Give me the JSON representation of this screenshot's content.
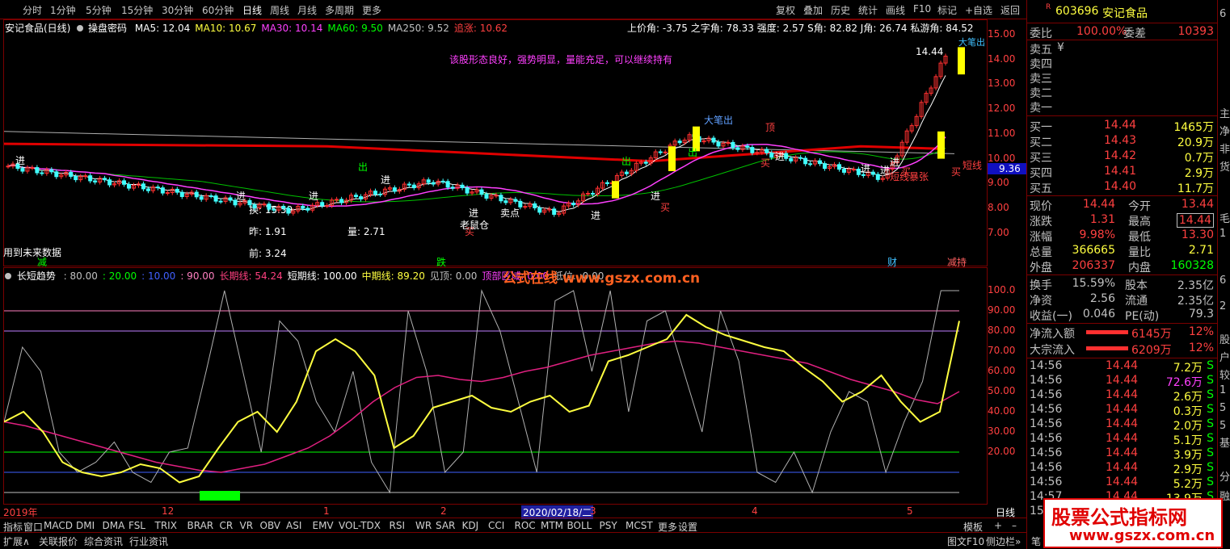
{
  "toolbar": {
    "periods": [
      "分时",
      "1分钟",
      "5分钟",
      "15分钟",
      "30分钟",
      "60分钟",
      "日线",
      "周线",
      "月线",
      "多周期",
      "更多"
    ],
    "active_period": "日线",
    "actions": [
      "复权",
      "叠加",
      "历史",
      "统计",
      "画线",
      "F10",
      "标记",
      "+自选",
      "返回"
    ]
  },
  "main_chart": {
    "stock_title": "安记食品(日线)",
    "indicator_name": "操盘密码",
    "ma_values": [
      {
        "label": "MA5: 12.04",
        "color": "#ffffff"
      },
      {
        "label": "MA10: 10.67",
        "color": "#ffff40"
      },
      {
        "label": "MA30: 10.14",
        "color": "#ff40ff"
      },
      {
        "label": "MA60: 9.50",
        "color": "#00ff00"
      },
      {
        "label": "MA250: 9.52",
        "color": "#c0c0c0"
      },
      {
        "label": "追涨: 10.62",
        "color": "#ff4040"
      }
    ],
    "right_stats": "上价角: -3.75  之字角: 78.33  强度: 2.57  S角: 82.82  J角: 26.74  私游角: 84.52",
    "comment": "该股形态良好，强势明显，量能充足，可以继续持有",
    "annotation_top": "大笔出",
    "price_peak": "14.44",
    "price_current": "9.36",
    "note_future": "用到未来数据",
    "stats_labels": [
      "换: 15.59",
      "昨: 1.91",
      "量: 2.71",
      "前: 3.24"
    ],
    "markers": [
      "进",
      "进",
      "进",
      "进",
      "出",
      "进",
      "出",
      "进",
      "进",
      "买",
      "出",
      "进",
      "买",
      "进",
      "买",
      "顶",
      "进",
      "进",
      "买",
      "大笔出",
      "短线",
      "短线暴张",
      "买",
      "卖点",
      "老鼠仓"
    ],
    "bottom_tags": [
      "减",
      "跌",
      "财",
      "减持"
    ],
    "price_axis": [
      "15.00",
      "14.00",
      "13.00",
      "12.00",
      "11.00",
      "10.00",
      "9.00",
      "8.00",
      "7.00"
    ],
    "colors": {
      "up": "#ff3030",
      "down": "#40ffff",
      "yellow_bar": "#ffff00",
      "ma_red": "#ff0000"
    }
  },
  "sub_chart": {
    "title": "长短趋势",
    "params": [
      {
        "label": ": 80.00",
        "color": "#c0c0c0"
      },
      {
        "label": ": 20.00",
        "color": "#00ff00"
      },
      {
        "label": ": 10.00",
        "color": "#4060ff"
      },
      {
        "label": ": 90.00",
        "color": "#ff80c0"
      },
      {
        "label": "长期线: 54.24",
        "color": "#ff4080"
      },
      {
        "label": "短期线: 100.00",
        "color": "#ffffff"
      },
      {
        "label": "中期线: 89.20",
        "color": "#ffff40"
      },
      {
        "label": "见顶: 0.00",
        "color": "#c0c0c0"
      },
      {
        "label": "顶部区域: 0.00",
        "color": "#ff40ff"
      },
      {
        "label": "低位..:0.00",
        "color": "#c0c0c0"
      }
    ],
    "axis": [
      "100.0",
      "90.00",
      "80.00",
      "70.00",
      "60.00",
      "50.00",
      "40.00",
      "30.00",
      "20.00"
    ]
  },
  "timeline": {
    "labels": [
      "2019年",
      "12",
      "1",
      "2",
      "2020/02/18/二",
      "3",
      "4",
      "5"
    ],
    "period_label": "日线"
  },
  "indicator_tabs": [
    "指标",
    "窗口",
    "MACD",
    "DMI",
    "DMA",
    "FSL",
    "TRIX",
    "BRAR",
    "CR",
    "VR",
    "OBV",
    "ASI",
    "EMV",
    "VOL-TDX",
    "RSI",
    "WR",
    "SAR",
    "KDJ",
    "CCI",
    "ROC",
    "MTM",
    "BOLL",
    "PSY",
    "MCST",
    "更多",
    "设置"
  ],
  "bottom_tabs": [
    "扩展∧",
    "关联报价",
    "综合资讯",
    "行业资讯"
  ],
  "bottom_right": [
    "模板",
    "+",
    "–",
    "图文F10",
    "侧边栏»",
    "笔"
  ],
  "watermark": {
    "top": "公式在线  www.gszx.com.cn",
    "box_line1": "股票公式指标网",
    "box_line2": "www.gszx.com.cn"
  },
  "quote_panel": {
    "code": "603696",
    "name": "安记食品",
    "weibi_label": "委比",
    "weibi": "100.00%",
    "weicha_label": "委差",
    "weicha": "10393",
    "sell": [
      {
        "label": "卖五",
        "price": "¥",
        "vol": ""
      },
      {
        "label": "卖四",
        "price": "",
        "vol": ""
      },
      {
        "label": "卖三",
        "price": "",
        "vol": ""
      },
      {
        "label": "卖二",
        "price": "",
        "vol": ""
      },
      {
        "label": "卖一",
        "price": "",
        "vol": ""
      }
    ],
    "buy": [
      {
        "label": "买一",
        "price": "14.44",
        "vol": "1465万"
      },
      {
        "label": "买二",
        "price": "14.43",
        "vol": "20.9万"
      },
      {
        "label": "买三",
        "price": "14.42",
        "vol": "0.7万"
      },
      {
        "label": "买四",
        "price": "14.41",
        "vol": "2.9万"
      },
      {
        "label": "买五",
        "price": "14.40",
        "vol": "11.7万"
      }
    ],
    "stats": [
      {
        "l1": "现价",
        "v1": "14.44",
        "l2": "今开",
        "v2": "13.44"
      },
      {
        "l1": "涨跌",
        "v1": "1.31",
        "l2": "最高",
        "v2": "14.44"
      },
      {
        "l1": "涨幅",
        "v1": "9.98%",
        "l2": "最低",
        "v2": "13.30"
      },
      {
        "l1": "总量",
        "v1": "366665",
        "l2": "量比",
        "v2": "2.71"
      },
      {
        "l1": "外盘",
        "v1": "206337",
        "l2": "内盘",
        "v2": "160328"
      }
    ],
    "stats2": [
      {
        "l1": "换手",
        "v1": "15.59%",
        "l2": "股本",
        "v2": "2.35亿"
      },
      {
        "l1": "净资",
        "v1": "2.56",
        "l2": "流通",
        "v2": "2.35亿"
      },
      {
        "l1": "收益(一)",
        "v1": "0.046",
        "l2": "PE(动)",
        "v2": "79.3"
      }
    ],
    "flows": [
      {
        "label": "净流入额",
        "value": "6145万",
        "pct": "12%"
      },
      {
        "label": "大宗流入",
        "value": "6209万",
        "pct": "12%"
      }
    ],
    "ticks": [
      {
        "t": "14:56",
        "p": "14.44",
        "v": "7.2万",
        "s": "S"
      },
      {
        "t": "14:56",
        "p": "14.44",
        "v": "72.6万",
        "s": "S"
      },
      {
        "t": "14:56",
        "p": "14.44",
        "v": "2.6万",
        "s": "S"
      },
      {
        "t": "14:56",
        "p": "14.44",
        "v": "0.3万",
        "s": "S"
      },
      {
        "t": "14:56",
        "p": "14.44",
        "v": "2.0万",
        "s": "S"
      },
      {
        "t": "14:56",
        "p": "14.44",
        "v": "5.1万",
        "s": "S"
      },
      {
        "t": "14:56",
        "p": "14.44",
        "v": "3.9万",
        "s": "S"
      },
      {
        "t": "14:56",
        "p": "14.44",
        "v": "2.9万",
        "s": "S"
      },
      {
        "t": "14:56",
        "p": "14.44",
        "v": "5.2万",
        "s": "S"
      },
      {
        "t": "14:57",
        "p": "14.44",
        "v": "13.9万",
        "s": "S"
      },
      {
        "t": "15:00",
        "p": "",
        "v": "",
        "s": ""
      }
    ],
    "edge_text": [
      "6",
      "主",
      "净",
      "非",
      "货",
      "毛",
      "1",
      "6",
      "2",
      "股",
      "户",
      "较",
      "1",
      "5",
      "5",
      "基",
      "分",
      "融"
    ]
  }
}
